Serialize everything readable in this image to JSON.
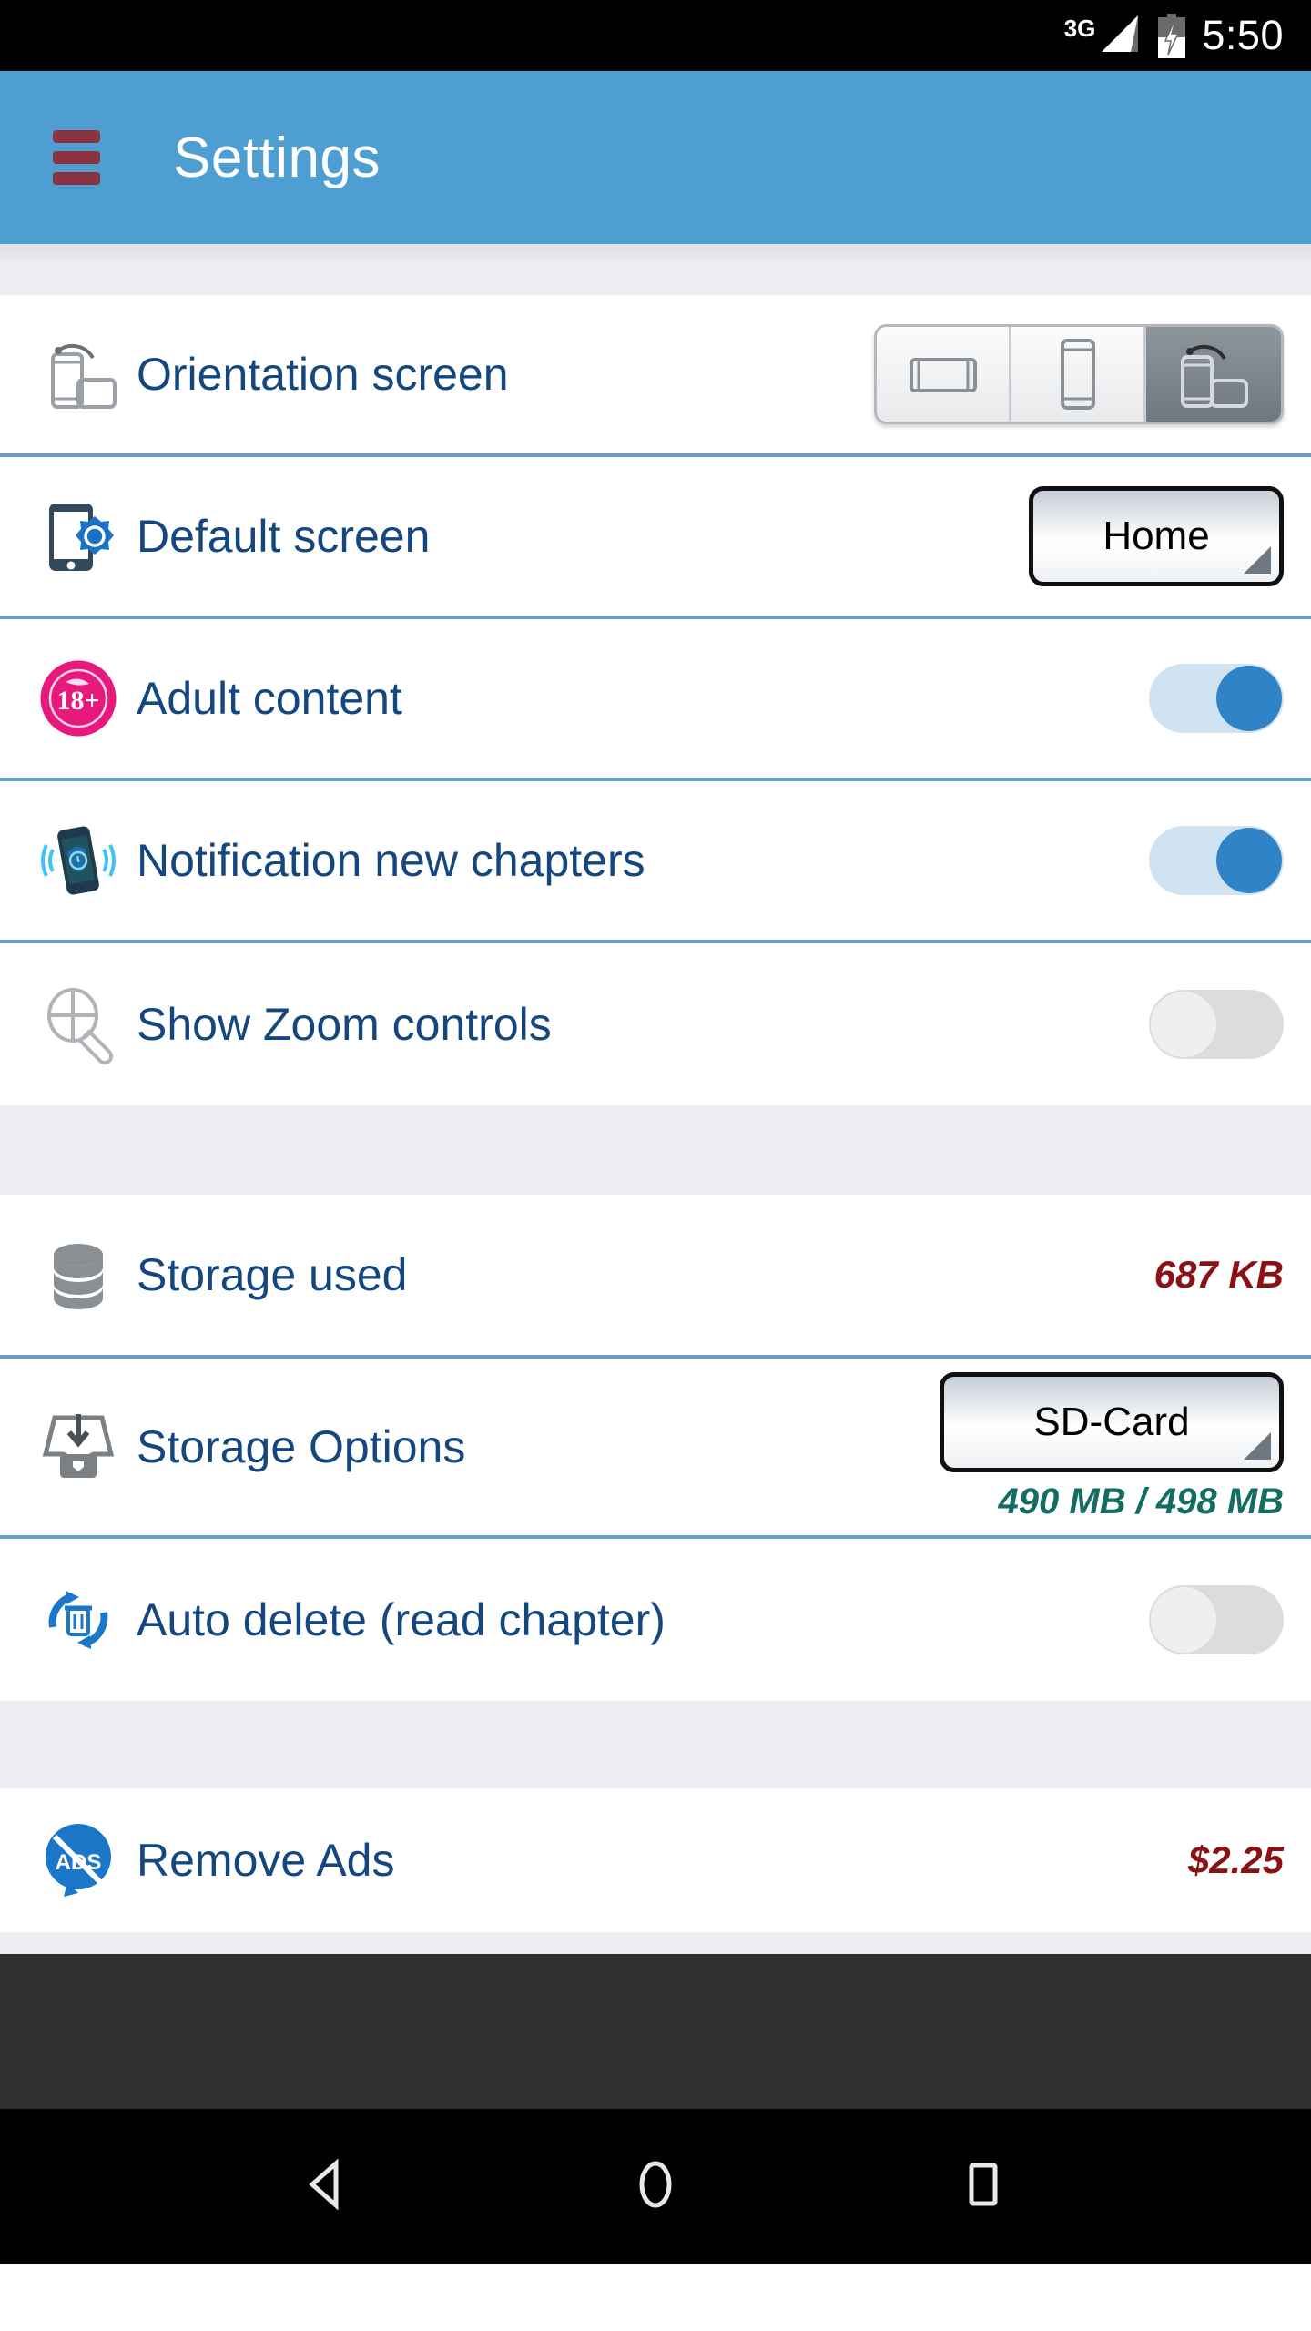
{
  "status_bar": {
    "network_type": "3G",
    "signal_icon": "signal-bars-icon",
    "battery_icon": "battery-charging-icon",
    "time": "5:50"
  },
  "app_bar": {
    "menu_icon": "hamburger-menu-icon",
    "title": "Settings",
    "background_color": "#4f9ed1",
    "menu_color": "#8a3340"
  },
  "sections": [
    {
      "rows": [
        {
          "icon": "screen-rotation-icon",
          "label": "Orientation screen",
          "control": "segmented",
          "options": [
            "landscape",
            "portrait",
            "auto-rotate"
          ],
          "selected_index": 2
        },
        {
          "icon": "default-screen-icon",
          "label": "Default screen",
          "control": "spinner",
          "value": "Home"
        },
        {
          "icon": "adult-content-18plus-icon",
          "label": "Adult content",
          "control": "switch",
          "value": "on"
        },
        {
          "icon": "notification-phone-icon",
          "label": "Notification new chapters",
          "control": "switch",
          "value": "on"
        },
        {
          "icon": "zoom-magnifier-icon",
          "label": "Show Zoom controls",
          "control": "switch",
          "value": "off"
        }
      ]
    },
    {
      "rows": [
        {
          "icon": "database-storage-icon",
          "label": "Storage used",
          "control": "value",
          "value": "687 KB",
          "value_color": "#8b1114"
        },
        {
          "icon": "storage-inbox-icon",
          "label": "Storage Options",
          "control": "spinner",
          "value": "SD-Card",
          "sub_value": "490 MB / 498 MB",
          "sub_value_color": "#136d62"
        },
        {
          "icon": "auto-delete-recycle-icon",
          "label": "Auto delete (read chapter)",
          "control": "switch",
          "value": "off"
        }
      ]
    },
    {
      "rows": [
        {
          "icon": "remove-ads-icon",
          "label": "Remove Ads",
          "control": "value",
          "value": "$2.25",
          "value_color": "#8b1114"
        }
      ]
    }
  ],
  "ad_banner": {
    "background_color": "#303030"
  },
  "nav_bar": {
    "back_icon": "back-triangle-icon",
    "home_icon": "home-circle-icon",
    "recents_icon": "recents-square-icon",
    "background_color": "#000000"
  }
}
